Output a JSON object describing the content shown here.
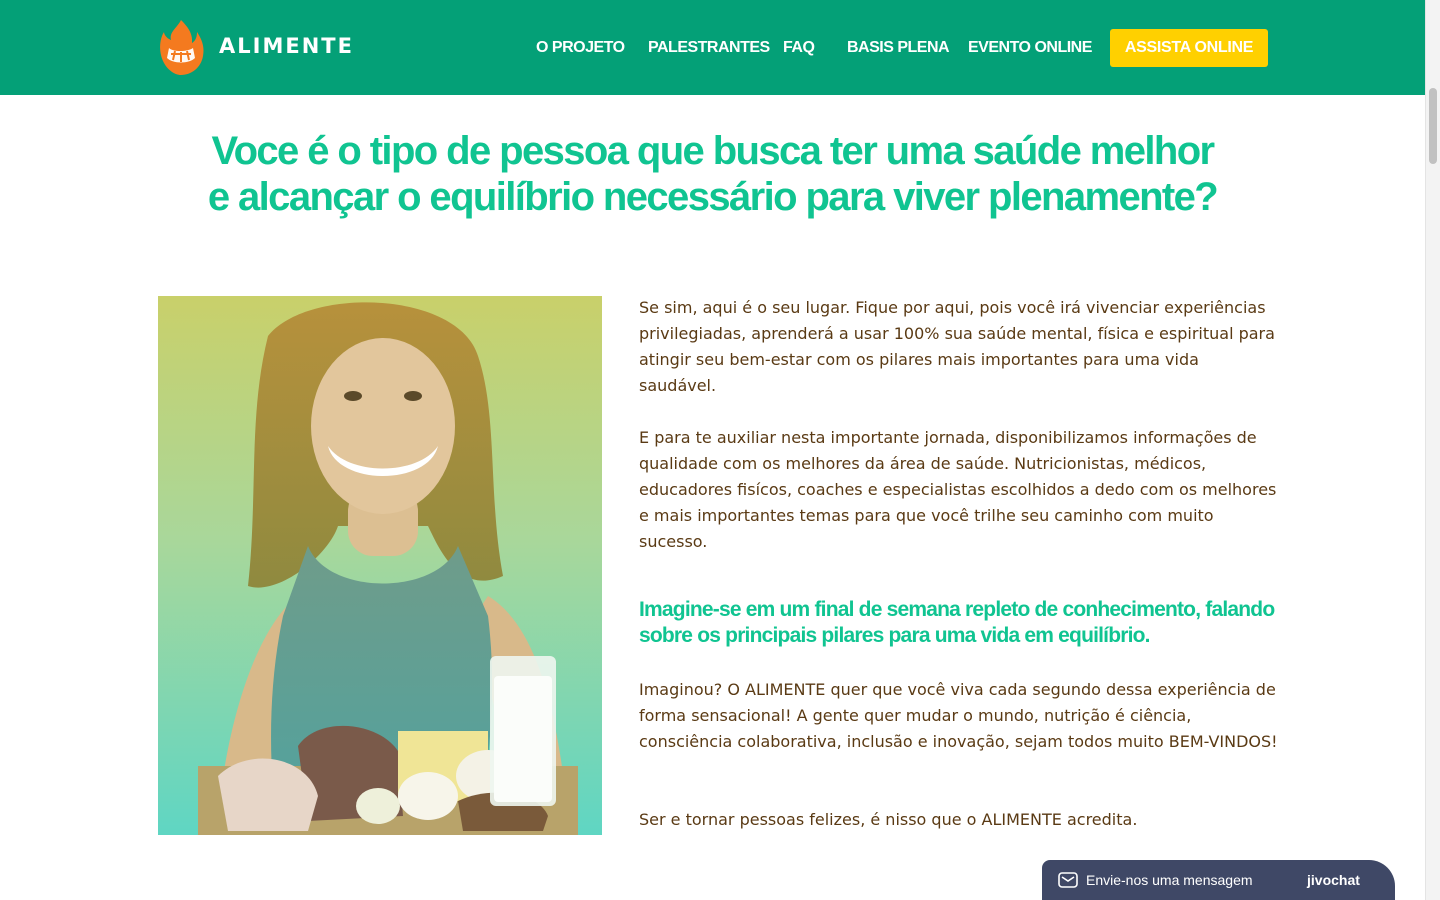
{
  "header": {
    "brand": "ALIMENTE",
    "nav": [
      {
        "label": "O PROJETO"
      },
      {
        "label": "PALESTRANTES"
      },
      {
        "label": "FAQ"
      },
      {
        "label": "BASIS PLENA"
      },
      {
        "label": "EVENTO ONLINE"
      }
    ],
    "cta_label": "ASSISTA ONLINE",
    "colors": {
      "bar": "#04a077",
      "cta": "#ffd000",
      "text": "#ffffff"
    }
  },
  "hero": {
    "line1_regular": "Voce é o tipo de pessoa que busca ter uma ",
    "line1_bold": "saúde melhor",
    "line2_regular_a": "e ",
    "line2_bold_a": "alcançar o equilíbrio",
    "line2_regular_b": " necessário para ",
    "line2_bold_b": "viver plenamente",
    "line2_end": "?",
    "color": "#10c491"
  },
  "content": {
    "p1": "Se sim, aqui é o seu lugar. Fique por aqui, pois você irá vivenciar experiências privilegiadas, aprenderá a usar 100% sua saúde mental, física e espiritual para atingir seu bem-estar com os pilares mais importantes para uma vida saudável.",
    "p2": "E para te auxiliar nesta importante jornada, disponibilizamos informações de qualidade com os melhores da área de saúde. Nutricionistas, médicos, educadores fisícos, coaches e especialistas escolhidos a dedo com os melhores e mais importantes temas para que você trilhe seu caminho com muito sucesso.",
    "subhead": "Imagine-se em um final de semana repleto de conhecimento, falando sobre os principais pilares para uma vida em equilíbrio.",
    "p3": "Imaginou? O ALIMENTE quer que você viva cada segundo dessa experiência de forma sensacional! A gente quer mudar o mundo, nutrição é ciência, consciência colaborativa, inclusão e inovação, sejam todos muito BEM-VINDOS!",
    "p4": "Ser e tornar pessoas felizes, é nisso que o ALIMENTE acredita.",
    "text_color": "#5a3a14"
  },
  "chat": {
    "label": "Envie-nos uma mensagem",
    "brand": "jivochat",
    "icon": "envelope-icon",
    "color": "#3f4866"
  }
}
